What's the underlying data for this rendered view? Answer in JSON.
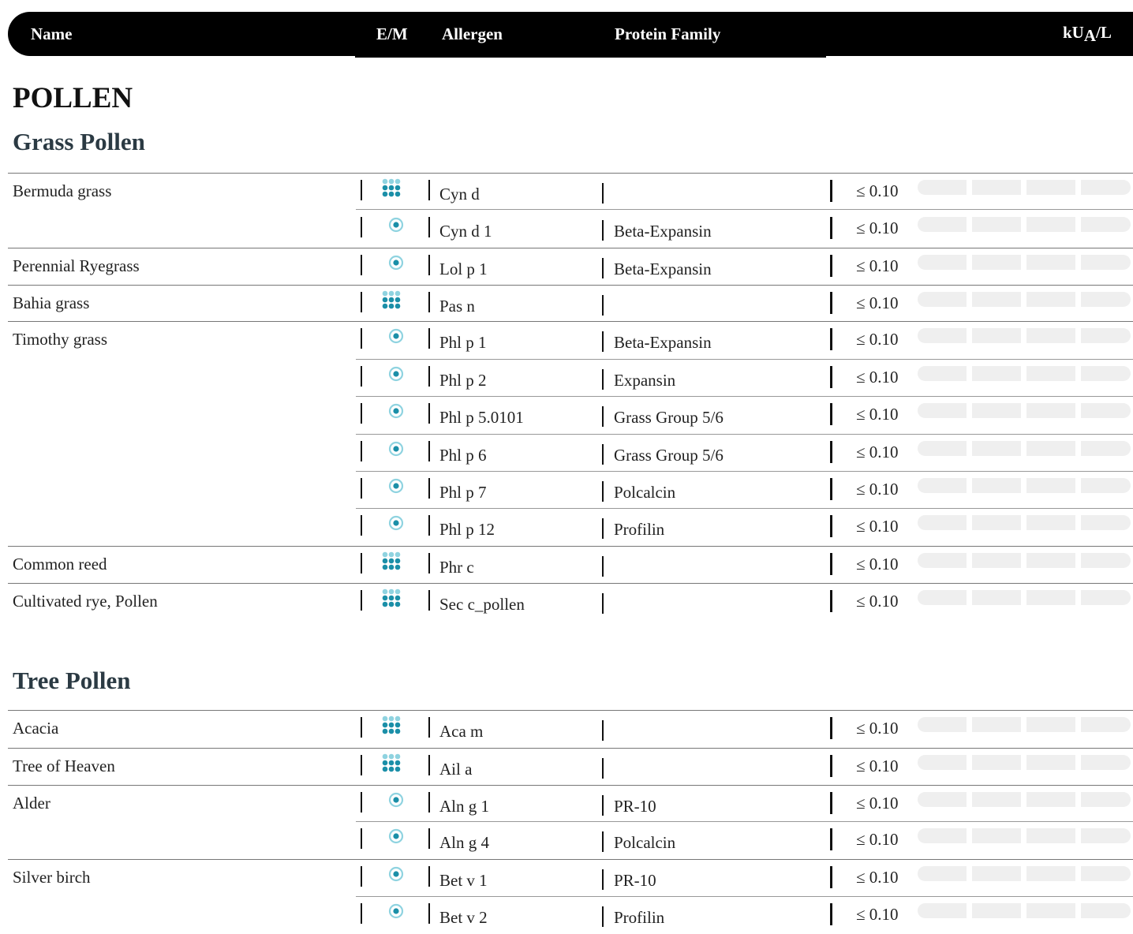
{
  "header": {
    "name": "Name",
    "em": "E/M",
    "allergen": "Allergen",
    "family": "Protein Family",
    "unit_main": "kU",
    "unit_sub": "A",
    "unit_tail": "/L"
  },
  "section": {
    "title": "POLLEN"
  },
  "groups": [
    {
      "title": "Grass Pollen"
    },
    {
      "title": "Tree Pollen"
    }
  ],
  "rows": [
    {
      "name": "Bermuda grass",
      "type": "extract",
      "allergen": "Cyn d",
      "family": "",
      "value": "≤ 0.10"
    },
    {
      "name": "",
      "type": "molecule",
      "allergen": "Cyn d 1",
      "family": "Beta-Expansin",
      "value": "≤ 0.10"
    },
    {
      "name": "Perennial Ryegrass",
      "type": "molecule",
      "allergen": "Lol p 1",
      "family": "Beta-Expansin",
      "value": "≤ 0.10"
    },
    {
      "name": "Bahia grass",
      "type": "extract",
      "allergen": "Pas n",
      "family": "",
      "value": "≤ 0.10"
    },
    {
      "name": "Timothy grass",
      "type": "molecule",
      "allergen": "Phl p 1",
      "family": "Beta-Expansin",
      "value": "≤ 0.10"
    },
    {
      "name": "",
      "type": "molecule",
      "allergen": "Phl p 2",
      "family": "Expansin",
      "value": "≤ 0.10"
    },
    {
      "name": "",
      "type": "molecule",
      "allergen": "Phl p 5.0101",
      "family": "Grass Group 5/6",
      "value": "≤ 0.10"
    },
    {
      "name": "",
      "type": "molecule",
      "allergen": "Phl p 6",
      "family": "Grass Group 5/6",
      "value": "≤ 0.10"
    },
    {
      "name": "",
      "type": "molecule",
      "allergen": "Phl p 7",
      "family": "Polcalcin",
      "value": "≤ 0.10"
    },
    {
      "name": "",
      "type": "molecule",
      "allergen": "Phl p 12",
      "family": "Profilin",
      "value": "≤ 0.10"
    },
    {
      "name": "Common reed",
      "type": "extract",
      "allergen": "Phr c",
      "family": "",
      "value": "≤ 0.10"
    },
    {
      "name": "Cultivated rye, Pollen",
      "type": "extract",
      "allergen": "Sec c_pollen",
      "family": "",
      "value": "≤ 0.10"
    },
    {
      "name": "Acacia",
      "type": "extract",
      "allergen": "Aca m",
      "family": "",
      "value": "≤ 0.10"
    },
    {
      "name": "Tree of Heaven",
      "type": "extract",
      "allergen": "Ail a",
      "family": "",
      "value": "≤ 0.10"
    },
    {
      "name": "Alder",
      "type": "molecule",
      "allergen": "Aln g 1",
      "family": "PR-10",
      "value": "≤ 0.10"
    },
    {
      "name": "",
      "type": "molecule",
      "allergen": "Aln g 4",
      "family": "Polcalcin",
      "value": "≤ 0.10"
    },
    {
      "name": "Silver birch",
      "type": "molecule",
      "allergen": "Bet v 1",
      "family": "PR-10",
      "value": "≤ 0.10"
    },
    {
      "name": "",
      "type": "molecule",
      "allergen": "Bet v 2",
      "family": "Profilin",
      "value": "≤ 0.10"
    }
  ],
  "icons": {
    "extract": "extract-dots-icon",
    "molecule": "molecule-target-icon"
  },
  "colors": {
    "icon_dark": "#1b8fa8",
    "icon_light": "#8fd3e0",
    "scale_bg": "#efefef"
  }
}
